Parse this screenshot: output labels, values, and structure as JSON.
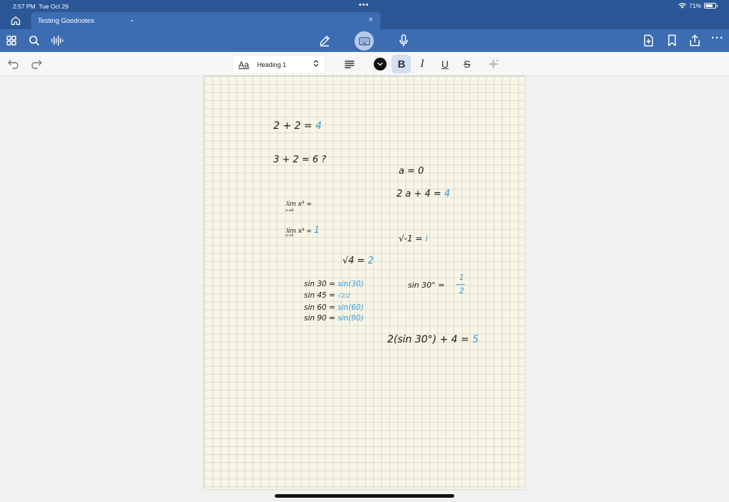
{
  "status": {
    "time": "2:57 PM",
    "date": "Tue Oct 29",
    "battery": "71%"
  },
  "tab": {
    "title": "Testing Goodnotes",
    "chevron": "⌄",
    "close": "×"
  },
  "toolbar": {
    "left_icons": [
      "grid-icon",
      "search-icon",
      "audio-icon"
    ],
    "center_icons": [
      "pen-icon",
      "keyboard-icon",
      "microphone-icon"
    ],
    "right_icons": [
      "add-page-icon",
      "bookmark-icon",
      "share-icon",
      "more-icon"
    ],
    "more": "···"
  },
  "format": {
    "style_aa": "Aa",
    "style_name": "Heading 1",
    "style_toggle": "⌃⌄",
    "bold": "B",
    "italic": "I",
    "underline": "U",
    "strike": "S"
  },
  "notes": {
    "eq1": "2 + 2 =",
    "eq1_ans": "4",
    "eq2": "3 + 2 = 6 ?",
    "a0": "a = 0",
    "a_eq": "2 a + 4 =",
    "a_eq_ans": "4",
    "lim1": "lim x³ =",
    "lim1_sub": "x→0",
    "lim2": "lim x³ =",
    "lim2_sub": "x→1",
    "lim2_ans": "1",
    "sqrtm1": "√-1 =",
    "sqrtm1_ans": "i",
    "sqrt4": "√4 =",
    "sqrt4_ans": "2",
    "sin30": "sin 30 =",
    "sin30_ans": "sin(30)",
    "sin45": "sin 45 =",
    "sin45_ans": "√2/2",
    "sin60": "sin 60 =",
    "sin60_ans": "sin(60)",
    "sin90": "sin 90 =",
    "sin90_ans": "sin(90)",
    "sin30deg": "sin 30° =",
    "sin30deg_num": "1",
    "sin30deg_den": "2",
    "final": "2(sin 30°) + 4 =",
    "final_ans": "5"
  },
  "colors": {
    "brand": "#2b5797",
    "toolbar": "#3c6db3",
    "answer": "#3a9ad9",
    "paper": "#f8f6e6"
  }
}
